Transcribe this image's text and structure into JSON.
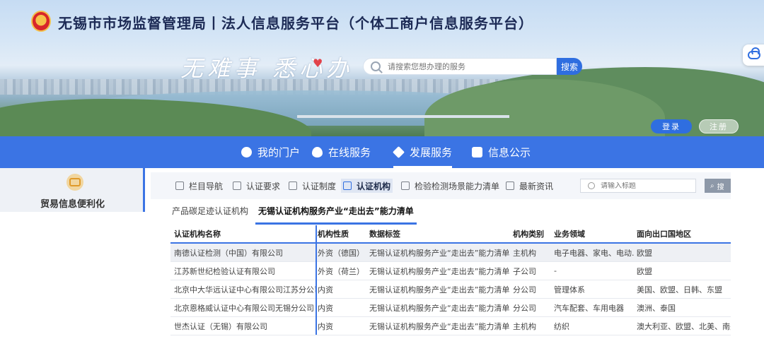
{
  "header": {
    "site_title": "无锡市市场监督管理局丨法人信息服务平台（个体工商户信息服务平台）",
    "slogan": "无难事 悉心办",
    "search": {
      "placeholder": "请搜索您想办理的服务",
      "button": "搜索"
    },
    "login": "登录",
    "register": "注册"
  },
  "nav": {
    "items": [
      {
        "label": "我的门户",
        "icon": "user-icon"
      },
      {
        "label": "在线服务",
        "icon": "eye-icon"
      },
      {
        "label": "发展服务",
        "icon": "layers-icon",
        "active": true
      },
      {
        "label": "信息公示",
        "icon": "message-icon"
      }
    ]
  },
  "sidebar": {
    "card_label": "贸易信息便利化",
    "icon": "coin-icon"
  },
  "tabs": {
    "items": [
      {
        "label": "栏目导航",
        "icon": "grid-icon"
      },
      {
        "label": "认证要求",
        "icon": "shield-icon"
      },
      {
        "label": "认证制度",
        "icon": "calendar-icon"
      },
      {
        "label": "认证机构",
        "icon": "building-icon",
        "active": true
      },
      {
        "label": "检验检测场景能力清单",
        "icon": "document-icon"
      },
      {
        "label": "最新资讯",
        "icon": "news-icon"
      }
    ],
    "search_placeholder": "请输入标题",
    "search_button": "搜"
  },
  "subtabs": {
    "items": [
      {
        "label": "产品碳足迹认证机构"
      },
      {
        "label": "无锡认证机构服务产业“走出去”能力清单",
        "active": true
      }
    ]
  },
  "table": {
    "columns": [
      "认证机构名称",
      "机构性质",
      "数据标签",
      "机构类别",
      "业务领域",
      "面向出口国地区"
    ],
    "rows": [
      [
        "南德认证检测（中国）有限公司",
        "外资（德国）",
        "无锡认证机构服务产业“走出去”能力清单",
        "主机构",
        "电子电器、家电、电动...",
        "欧盟"
      ],
      [
        "江苏新世纪检验认证有限公司",
        "外资（荷兰）",
        "无锡认证机构服务产业“走出去”能力清单",
        "子公司",
        "-",
        "欧盟"
      ],
      [
        "北京中大华远认证中心有限公司江苏分公司",
        "内资",
        "无锡认证机构服务产业“走出去”能力清单",
        "分公司",
        "管理体系",
        "美国、欧盟、日韩、东盟"
      ],
      [
        "北京恩格威认证中心有限公司无锡分公司",
        "内资",
        "无锡认证机构服务产业“走出去”能力清单",
        "分公司",
        "汽车配套、车用电器",
        "澳洲、泰国"
      ],
      [
        "世杰认证（无锡）有限公司",
        "内资",
        "无锡认证机构服务产业“走出去”能力清单",
        "主机构",
        "纺织",
        "澳大利亚、欧盟、北美、南美"
      ]
    ]
  },
  "colors": {
    "primary": "#3b74e4",
    "title": "#1c2a55"
  }
}
